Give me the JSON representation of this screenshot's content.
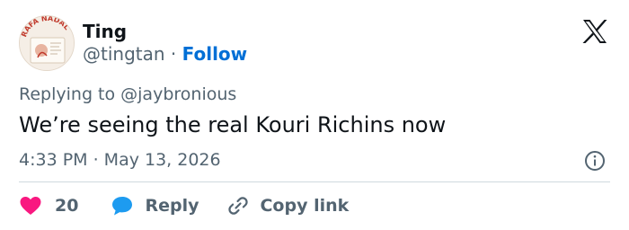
{
  "author": {
    "name": "Ting",
    "handle": "@tingtan",
    "separator": "·",
    "follow_label": "Follow",
    "avatar_text": "RAFA NADAL"
  },
  "tweet": {
    "replying_to": "Replying to @jaybronious",
    "text": "We’re seeing the real Kouri Richins now",
    "timestamp": "4:33 PM · May 13, 2026"
  },
  "actions": {
    "like_count": "20",
    "reply_label": "Reply",
    "copy_label": "Copy link"
  },
  "colors": {
    "accent": "#006fd6",
    "like": "#f91880",
    "reply": "#1d9bf0",
    "muted": "#536471",
    "text": "#0f1419"
  },
  "icons": [
    "x-logo-icon",
    "info-icon",
    "heart-icon",
    "reply-bubble-icon",
    "link-icon"
  ]
}
